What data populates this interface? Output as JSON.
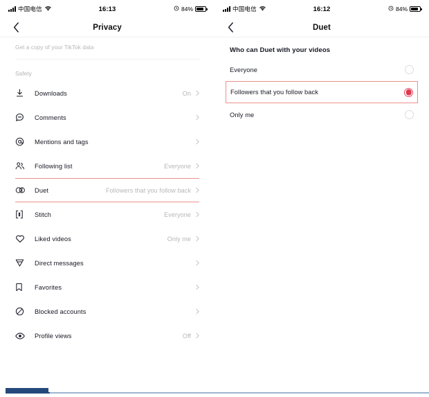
{
  "left_phone": {
    "status_bar": {
      "carrier": "中国电信",
      "time": "16:13",
      "battery_text": "84%",
      "battery_level": 84,
      "signal_icon": "signal-bars-icon",
      "wifi_icon": "wifi-icon",
      "alarm_icon": "alarm-icon"
    },
    "nav": {
      "back_icon": "chevron-left-icon",
      "title": "Privacy"
    },
    "subtitle": "Get a copy of your TikTok data",
    "section_label": "Safety",
    "rows": [
      {
        "icon": "download-icon",
        "label": "Downloads",
        "value": "On",
        "highlighted": false
      },
      {
        "icon": "comment-icon",
        "label": "Comments",
        "value": "",
        "highlighted": false
      },
      {
        "icon": "mention-at-icon",
        "label": "Mentions and tags",
        "value": "",
        "highlighted": false
      },
      {
        "icon": "people-icon",
        "label": "Following list",
        "value": "Everyone",
        "highlighted": false
      },
      {
        "icon": "duet-icon",
        "label": "Duet",
        "value": "Followers that you follow back",
        "highlighted": true
      },
      {
        "icon": "stitch-icon",
        "label": "Stitch",
        "value": "Everyone",
        "highlighted": false
      },
      {
        "icon": "heart-icon",
        "label": "Liked videos",
        "value": "Only me",
        "highlighted": false
      },
      {
        "icon": "paper-plane-icon",
        "label": "Direct messages",
        "value": "",
        "highlighted": false
      },
      {
        "icon": "bookmark-icon",
        "label": "Favorites",
        "value": "",
        "highlighted": false
      },
      {
        "icon": "blocked-icon",
        "label": "Blocked accounts",
        "value": "",
        "highlighted": false
      },
      {
        "icon": "eye-icon",
        "label": "Profile views",
        "value": "Off",
        "highlighted": false
      }
    ],
    "chevron_icon": "chevron-right-icon"
  },
  "right_phone": {
    "status_bar": {
      "carrier": "中国电信",
      "time": "16:12",
      "battery_text": "84%",
      "battery_level": 84,
      "signal_icon": "signal-bars-icon",
      "wifi_icon": "wifi-icon",
      "alarm_icon": "alarm-icon"
    },
    "nav": {
      "back_icon": "chevron-left-icon",
      "title": "Duet"
    },
    "options_header": "Who can Duet with your videos",
    "options": [
      {
        "label": "Everyone",
        "selected": false,
        "highlighted": false
      },
      {
        "label": "Followers that you follow back",
        "selected": true,
        "highlighted": true
      },
      {
        "label": "Only me",
        "selected": false,
        "highlighted": false
      }
    ]
  },
  "colors": {
    "accent_red": "#e23950",
    "highlight_border": "#e8928c",
    "muted_text": "#b6b6b6",
    "primary_text": "#161823",
    "progress_fill": "#25497c",
    "progress_track": "#9fb4d0"
  },
  "progress": {
    "percent": 10.5
  }
}
